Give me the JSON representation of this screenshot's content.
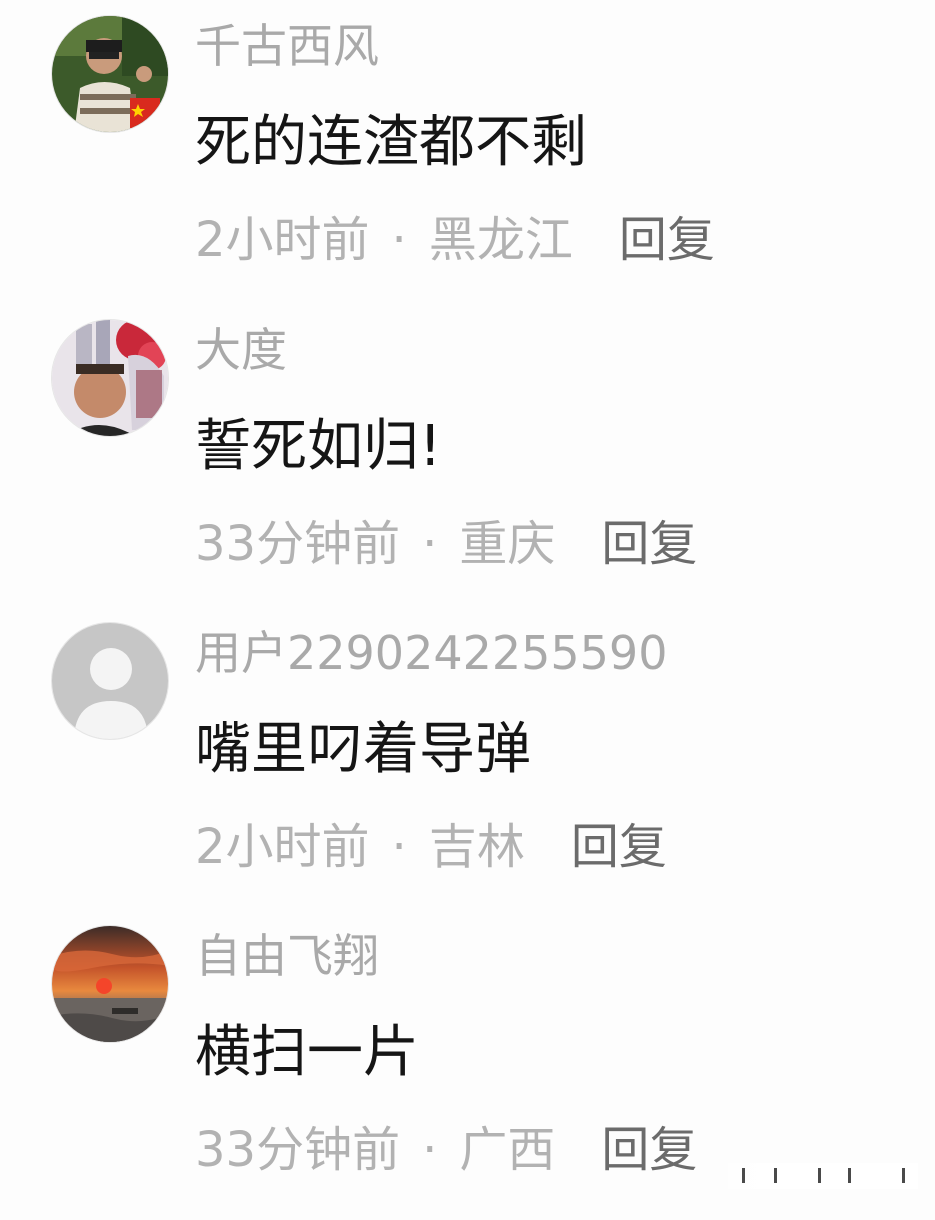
{
  "comments": [
    {
      "username": "千古西风",
      "text": "死的连渣都不剩",
      "time": "2小时前",
      "separator": "·",
      "location": "黑龙江",
      "reply": "回复",
      "avatar_icon": "person-selfie-with-flag-avatar"
    },
    {
      "username": "大度",
      "text": "誓死如归!",
      "time": "33分钟前",
      "separator": "·",
      "location": "重庆",
      "reply": "回复",
      "avatar_icon": "elderly-man-portrait-avatar"
    },
    {
      "username": "用户2290242255590",
      "text": "嘴里叼着导弹",
      "time": "2小时前",
      "separator": "·",
      "location": "吉林",
      "reply": "回复",
      "avatar_icon": "default-user-avatar"
    },
    {
      "username": "自由飞翔",
      "text": "横扫一片",
      "time": "33分钟前",
      "separator": "·",
      "location": "广西",
      "reply": "回复",
      "avatar_icon": "sunset-over-sea-avatar"
    }
  ],
  "colors": {
    "background": "#fdfdfd",
    "username": "#a9a9a9",
    "comment_text": "#151515",
    "meta": "#b2b2b2",
    "reply": "#6b6b6b"
  }
}
